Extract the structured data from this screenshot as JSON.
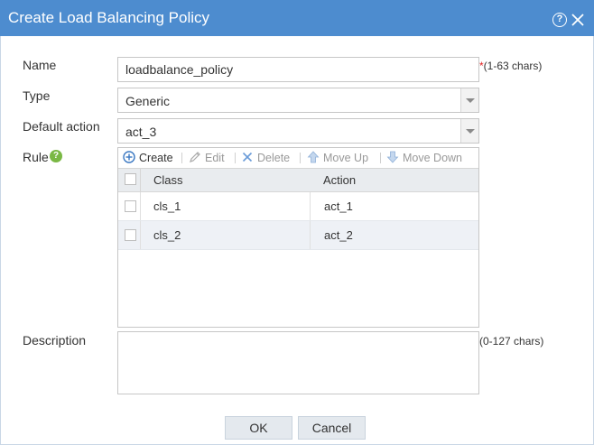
{
  "dialog": {
    "title": "Create Load Balancing Policy",
    "help_glyph": "?"
  },
  "form": {
    "name": {
      "label": "Name",
      "value": "loadbalance_policy",
      "required_mark": "*",
      "hint": "(1-63 chars)"
    },
    "type": {
      "label": "Type",
      "value": "Generic"
    },
    "default_action": {
      "label": "Default action",
      "value": "act_3"
    },
    "rule": {
      "label": "Rule",
      "help_glyph": "?",
      "toolbar": {
        "create": "Create",
        "edit": "Edit",
        "delete": "Delete",
        "move_up": "Move Up",
        "move_down": "Move Down"
      },
      "columns": {
        "class": "Class",
        "action": "Action"
      },
      "rows": [
        {
          "class": "cls_1",
          "action": "act_1"
        },
        {
          "class": "cls_2",
          "action": "act_2"
        }
      ]
    },
    "description": {
      "label": "Description",
      "value": "",
      "hint": "(0-127 chars)"
    }
  },
  "footer": {
    "ok_label": "OK",
    "cancel_label": "Cancel"
  },
  "colors": {
    "titlebar": "#4d8ccf",
    "required": "#e02020",
    "rule_help": "#7ab844",
    "create_icon": "#3a78c2",
    "delete_icon": "#6a9bd8",
    "row_alt": "#eef1f6"
  },
  "icons": {
    "help": "help-icon",
    "close": "close-icon",
    "create": "plus-circle-icon",
    "edit": "pencil-icon",
    "delete": "x-icon",
    "move_up": "arrow-up-icon",
    "move_down": "arrow-down-icon",
    "dropdown": "chevron-down-icon"
  }
}
